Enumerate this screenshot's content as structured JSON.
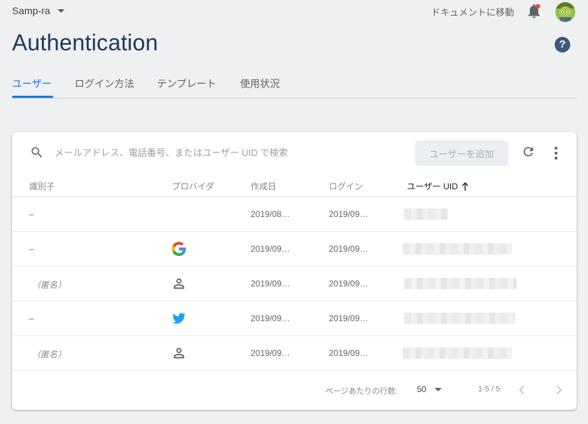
{
  "header": {
    "project_name": "Samp-ra",
    "docs_link": "ドキュメントに移動",
    "notification_color": "#f44336"
  },
  "page": {
    "title": "Authentication",
    "help_glyph": "?"
  },
  "tabs": [
    {
      "label": "ユーザー",
      "active": true
    },
    {
      "label": "ログイン方法",
      "active": false
    },
    {
      "label": "テンプレート",
      "active": false
    },
    {
      "label": "使用状況",
      "active": false
    }
  ],
  "toolbar": {
    "search_placeholder": "メールアドレス、電話番号、またはユーザー UID で検索",
    "add_user_label": "ユーザーを追加"
  },
  "table": {
    "columns": {
      "identifier": "識別子",
      "provider": "プロバイダ",
      "created": "作成日",
      "signed_in": "ログイン",
      "uid": "ユーザー UID"
    },
    "sort_icon": "arrow-up-icon",
    "rows": [
      {
        "identifier": "–",
        "provider": "none",
        "created": "2019/08…",
        "signed_in": "2019/09…",
        "anonymous": false
      },
      {
        "identifier": "–",
        "provider": "google-icon",
        "created": "2019/09…",
        "signed_in": "2019/09…",
        "anonymous": false
      },
      {
        "identifier": "（匿名）",
        "provider": "person-icon",
        "created": "2019/09…",
        "signed_in": "2019/09…",
        "anonymous": true
      },
      {
        "identifier": "–",
        "provider": "twitter-icon",
        "created": "2019/09…",
        "signed_in": "2019/09…",
        "anonymous": false
      },
      {
        "identifier": "（匿名）",
        "provider": "person-icon",
        "created": "2019/09…",
        "signed_in": "2019/09…",
        "anonymous": true
      }
    ]
  },
  "footer": {
    "rows_per_page_label": "ページあたりの行数:",
    "rows_per_page_value": "50",
    "range_text": "1-5 / 5"
  },
  "colors": {
    "accent": "#1a73e8",
    "title": "#1f3a56",
    "twitter": "#1da1f2"
  }
}
